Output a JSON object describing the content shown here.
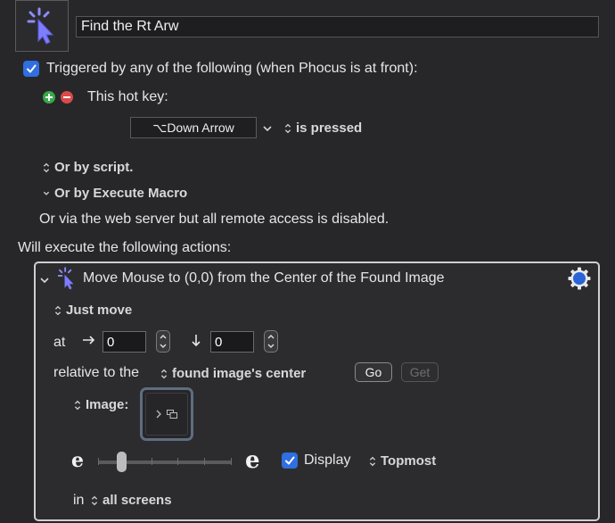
{
  "macro": {
    "name": "Find the Rt Arw",
    "icon": "cursor-click-icon"
  },
  "trigger": {
    "label": "Triggered by any of the following (when Phocus is at front):",
    "checked": true,
    "hotkey_label": "This hot key:",
    "hotkey_value": "⌥Down Arrow",
    "hotkey_state": "is pressed",
    "or_by_script": "Or by script.",
    "or_by_execute_macro": "Or by Execute Macro",
    "web_server_note": "Or via the web server but all remote access is disabled."
  },
  "actions_header": "Will execute the following actions:",
  "action": {
    "title": "Move Mouse to (0,0) from the Center of the Found Image",
    "mode": "Just move",
    "at_label": "at",
    "x_value": "0",
    "y_value": "0",
    "relative_label": "relative to the",
    "relative_value": "found image's center",
    "go_label": "Go",
    "get_label": "Get",
    "image_label": "Image:",
    "display_label": "Display",
    "display_checked": true,
    "topmost_label": "Topmost",
    "in_label": "in",
    "screens_value": "all screens",
    "slider_min_glyph": "e",
    "slider_max_glyph": "e",
    "slider_position": 0.17
  },
  "colors": {
    "background": "#27272a",
    "checkbox_blue": "#2f6fe0",
    "plus_green": "#3aa848",
    "minus_red": "#d94a4a",
    "gear_blue": "#2a64d6"
  }
}
